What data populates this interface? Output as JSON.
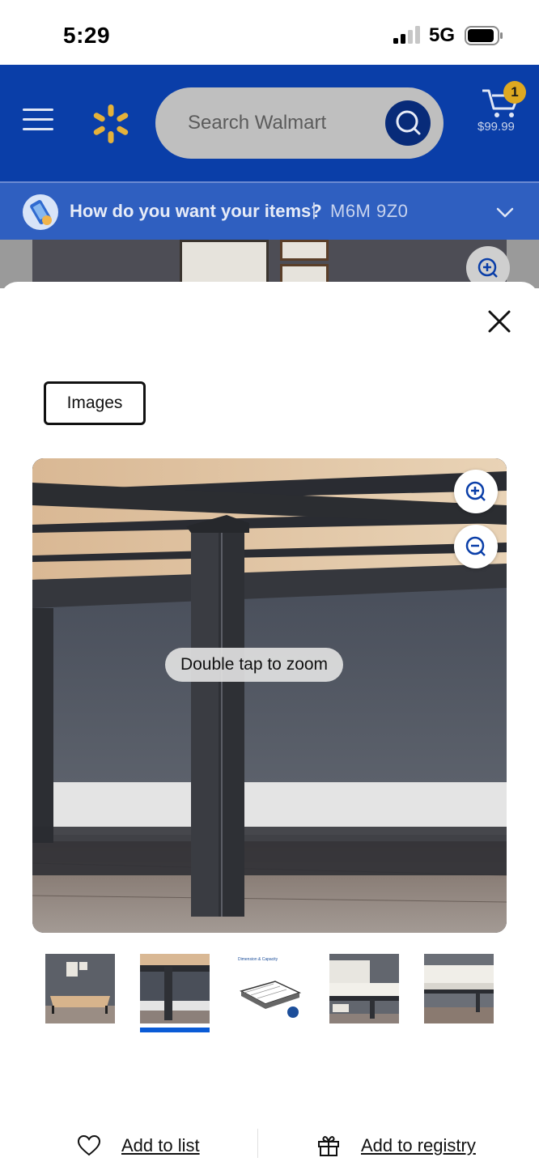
{
  "status_bar": {
    "time": "5:29",
    "network": "5G",
    "signal_icon": "cellular-signal-icon",
    "battery_icon": "battery-icon"
  },
  "header": {
    "menu_icon": "hamburger-menu-icon",
    "logo_icon": "walmart-spark-logo",
    "search_placeholder": "Search Walmart",
    "search_icon": "search-icon",
    "cart_icon": "cart-icon",
    "cart_count": "1",
    "cart_total": "$99.99",
    "colors": {
      "brand_blue": "#0a3ea8",
      "badge_yellow": "#dea821"
    }
  },
  "delivery": {
    "question": "How do you want your items?",
    "separator": "|",
    "postal_code": "M6M 9Z0",
    "chevron_icon": "chevron-down-icon"
  },
  "sheet": {
    "close_icon": "close-icon",
    "tab_label": "Images",
    "zoom_in_icon": "zoom-in-icon",
    "zoom_out_icon": "zoom-out-icon",
    "hint": "Double tap to zoom",
    "thumbnail_count": 5,
    "selected_thumbnail": 2,
    "thumbnails": [
      "Bed frame in room",
      "Bed frame leg close-up",
      "Dimension & Capacity",
      "Bed frame side view",
      "Bed frame with bedding"
    ],
    "thumb3_caption": "Dimension & Capacity",
    "actions": {
      "add_to_list": "Add to list",
      "add_to_list_icon": "heart-icon",
      "add_to_registry": "Add to registry",
      "add_to_registry_icon": "gift-icon"
    }
  }
}
